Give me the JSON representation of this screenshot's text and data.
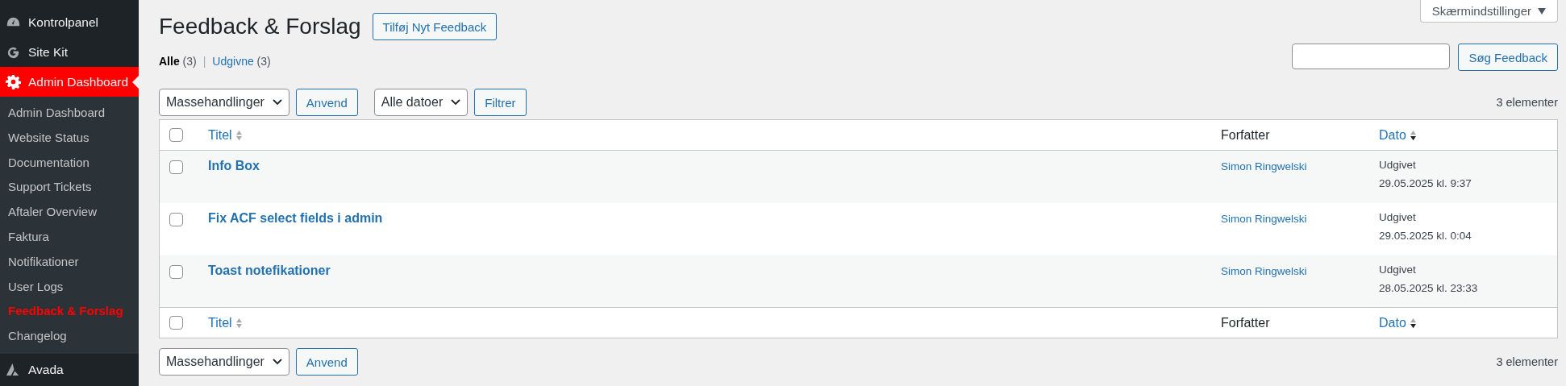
{
  "sidebar": {
    "top_items": [
      {
        "kind": "gauge",
        "label": "Kontrolpanel",
        "selected": false
      },
      {
        "kind": "g",
        "label": "Site Kit",
        "selected": false
      },
      {
        "kind": "gear",
        "label": "Admin Dashboard",
        "selected": true
      }
    ],
    "submenu": [
      {
        "label": "Admin Dashboard",
        "selected": false
      },
      {
        "label": "Website Status",
        "selected": false
      },
      {
        "label": "Documentation",
        "selected": false
      },
      {
        "label": "Support Tickets",
        "selected": false
      },
      {
        "label": "Aftaler Overview",
        "selected": false
      },
      {
        "label": "Faktura",
        "selected": false
      },
      {
        "label": "Notifikationer",
        "selected": false
      },
      {
        "label": "User Logs",
        "selected": false
      },
      {
        "label": "Feedback & Forslag",
        "selected": true
      },
      {
        "label": "Changelog",
        "selected": false
      }
    ],
    "bottom_items": [
      {
        "kind": "avada",
        "label": "Avada",
        "selected": false
      }
    ]
  },
  "screen_options": "Skærmindstillinger",
  "page_title": "Feedback & Forslag",
  "add_button": "Tilføj Nyt Feedback",
  "views": [
    {
      "label": "Alle",
      "count": "(3)",
      "selected": true
    },
    {
      "separator": "|",
      "label": "Udgivne",
      "count": "(3)",
      "selected": false
    }
  ],
  "search": {
    "button": "Søg Feedback"
  },
  "top_actions": {
    "bulk": "Massehandlinger",
    "apply": "Anvend",
    "dates": "Alle datoer",
    "filter": "Filtrer",
    "count": "3 elementer"
  },
  "table": {
    "header_checked": false,
    "footer_checked": false,
    "columns": [
      {
        "label": "Titel",
        "sortable": true,
        "sorted": false
      },
      {
        "label": "Forfatter",
        "sortable": false,
        "sorted": false
      },
      {
        "label": "Dato",
        "sortable": true,
        "sorted": true
      }
    ],
    "footer_columns": [
      {
        "label": "Titel",
        "sortable": true,
        "sorted": false
      },
      {
        "label": "Forfatter",
        "sortable": false,
        "sorted": false
      },
      {
        "label": "Dato",
        "sortable": true,
        "sorted": true
      }
    ],
    "rows": [
      {
        "checked": false,
        "title": "Info Box",
        "author": "Simon Ringwelski",
        "status": "Udgivet",
        "date": "29.05.2025 kl. 9:37"
      },
      {
        "checked": false,
        "title": "Fix ACF select fields i admin",
        "author": "Simon Ringwelski",
        "status": "Udgivet",
        "date": "29.05.2025 kl. 0:04"
      },
      {
        "checked": false,
        "title": "Toast notefikationer",
        "author": "Simon Ringwelski",
        "status": "Udgivet",
        "date": "28.05.2025 kl. 23:33"
      }
    ]
  },
  "bottom_actions": {
    "bulk": "Massehandlinger",
    "apply": "Anvend",
    "count": "3 elementer"
  }
}
